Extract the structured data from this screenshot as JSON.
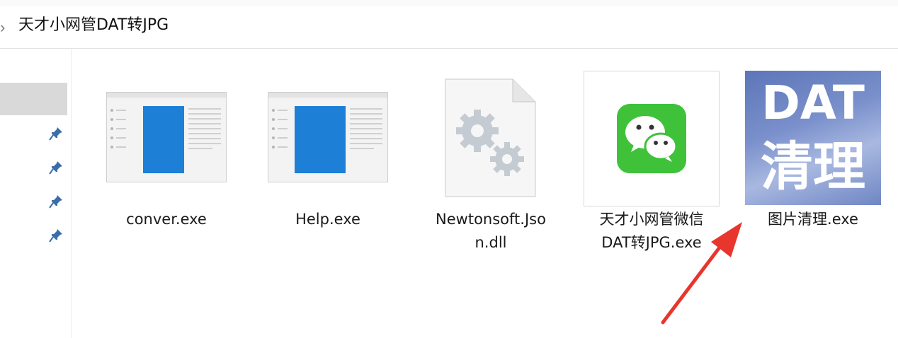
{
  "address": {
    "breadcrumb_chevron": "›",
    "path_text": "天才小网管DAT转JPG"
  },
  "nav": {
    "pinned_count": 4,
    "pin_icon": "pin-icon"
  },
  "files": [
    {
      "name": "conver.exe",
      "icon": "app-window-icon"
    },
    {
      "name": "Help.exe",
      "icon": "app-window-icon"
    },
    {
      "name_line1": "Newtonsoft.Jso",
      "name_line2": "n.dll",
      "icon": "gear-file-icon"
    },
    {
      "name_line1": "天才小网管微信",
      "name_line2": "DAT转JPG.exe",
      "icon": "wechat-icon"
    },
    {
      "name": "图片清理.exe",
      "icon": "dat-clean-icon",
      "icon_text_1": "DAT",
      "icon_text_2": "清理"
    }
  ],
  "colors": {
    "accent_blue": "#1e7fd6",
    "wechat_green": "#3fc23a",
    "arrow_red": "#e8352d"
  }
}
